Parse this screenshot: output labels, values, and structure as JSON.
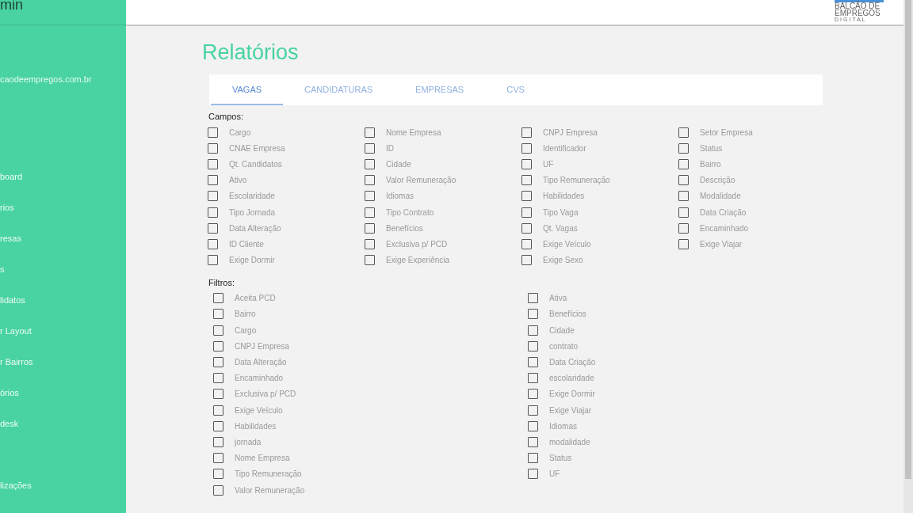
{
  "sidebar": {
    "title": "min",
    "email": "caodeempregos.com.br",
    "items": [
      {
        "label": "board"
      },
      {
        "label": "rios"
      },
      {
        "label": "resas"
      },
      {
        "label": "s"
      },
      {
        "label": "lidatos"
      },
      {
        "label": "r Layout"
      },
      {
        "label": "r Bairros"
      },
      {
        "label": "órios"
      },
      {
        "label": "desk"
      },
      {
        "label": "lizações"
      }
    ]
  },
  "header": {
    "logo_lines": [
      "BALCÃO DE",
      "EMPREGOS",
      "DIGITAL"
    ]
  },
  "page_title": "Relatórios",
  "tabs": [
    {
      "label": "VAGAS",
      "selected": true
    },
    {
      "label": "CANDIDATURAS",
      "selected": false
    },
    {
      "label": "EMPRESAS",
      "selected": false
    },
    {
      "label": "CVS",
      "selected": false
    }
  ],
  "fields": {
    "heading": "Campos:",
    "items": [
      {
        "label": "Cargo",
        "checked": false
      },
      {
        "label": "Nome Empresa",
        "checked": false
      },
      {
        "label": "CNPJ Empresa",
        "checked": false
      },
      {
        "label": "Setor Empresa",
        "checked": false
      },
      {
        "label": "CNAE Empresa",
        "checked": false
      },
      {
        "label": "ID",
        "checked": false
      },
      {
        "label": "Identificador",
        "checked": false
      },
      {
        "label": "Status",
        "checked": false
      },
      {
        "label": "Qt. Candidatos",
        "checked": false
      },
      {
        "label": "Cidade",
        "checked": false
      },
      {
        "label": "UF",
        "checked": false
      },
      {
        "label": "Bairro",
        "checked": false
      },
      {
        "label": "Ativo",
        "checked": false
      },
      {
        "label": "Valor Remuneração",
        "checked": false
      },
      {
        "label": "Tipo Remuneração",
        "checked": false
      },
      {
        "label": "Descrição",
        "checked": false
      },
      {
        "label": "Escolaridade",
        "checked": false
      },
      {
        "label": "Idiomas",
        "checked": false
      },
      {
        "label": "Habilidades",
        "checked": false
      },
      {
        "label": "Modalidade",
        "checked": false
      },
      {
        "label": "Tipo Jornada",
        "checked": false
      },
      {
        "label": "Tipo Contrato",
        "checked": false
      },
      {
        "label": "Tipo Vaga",
        "checked": false
      },
      {
        "label": "Data Criação",
        "checked": false
      },
      {
        "label": "Data Alteração",
        "checked": false
      },
      {
        "label": "Benefícios",
        "checked": false
      },
      {
        "label": "Qt. Vagas",
        "checked": false
      },
      {
        "label": "Encaminhado",
        "checked": false
      },
      {
        "label": "ID Cliente",
        "checked": false
      },
      {
        "label": "Exclusiva p/ PCD",
        "checked": false
      },
      {
        "label": "Exige Veículo",
        "checked": false
      },
      {
        "label": "Exige Viajar",
        "checked": false
      },
      {
        "label": "Exige Dormir",
        "checked": false
      },
      {
        "label": "Exige Experiência",
        "checked": false
      },
      {
        "label": "Exige Sexo",
        "checked": false
      }
    ]
  },
  "filters": {
    "heading": "Filtros:",
    "items": [
      {
        "label": "Aceita PCD",
        "checked": false
      },
      {
        "label": "Ativa",
        "checked": false
      },
      {
        "label": "Bairro",
        "checked": false
      },
      {
        "label": "Benefícios",
        "checked": false
      },
      {
        "label": "Cargo",
        "checked": false
      },
      {
        "label": "Cidade",
        "checked": false
      },
      {
        "label": "CNPJ Empresa",
        "checked": false
      },
      {
        "label": "contrato",
        "checked": false
      },
      {
        "label": "Data Alteração",
        "checked": false
      },
      {
        "label": "Data Criação",
        "checked": false
      },
      {
        "label": "Encaminhado",
        "checked": false
      },
      {
        "label": "escolaridade",
        "checked": false
      },
      {
        "label": "Exclusiva p/ PCD",
        "checked": false
      },
      {
        "label": "Exige Dormir",
        "checked": false
      },
      {
        "label": "Exige Veículo",
        "checked": false
      },
      {
        "label": "Exige Viajar",
        "checked": false
      },
      {
        "label": "Habilidades",
        "checked": false
      },
      {
        "label": "Idiomas",
        "checked": false
      },
      {
        "label": "jornada",
        "checked": false
      },
      {
        "label": "modalidade",
        "checked": false
      },
      {
        "label": "Nome Empresa",
        "checked": false
      },
      {
        "label": "Status",
        "checked": false
      },
      {
        "label": "Tipo Remuneração",
        "checked": false
      },
      {
        "label": "UF",
        "checked": false
      },
      {
        "label": "Valor Remuneração",
        "checked": false
      }
    ]
  }
}
